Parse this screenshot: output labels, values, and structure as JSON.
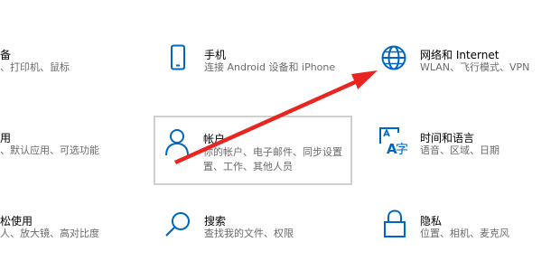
{
  "settings_tiles": [
    {
      "id": "devices",
      "title": "备",
      "desc": [
        "、打印机、鼠标"
      ]
    },
    {
      "id": "phone",
      "title": "手机",
      "desc": [
        "连接 Android 设备和 iPhone"
      ]
    },
    {
      "id": "network",
      "title": "网络和 Internet",
      "desc": [
        "WLAN、飞行模式、VPN"
      ]
    },
    {
      "id": "apps",
      "title": "用",
      "desc": [
        "、默认应用、可选功能"
      ]
    },
    {
      "id": "accounts",
      "title": "帐户",
      "desc": [
        "你的帐户、电子邮件、同步设置",
        "置、工作、其他人员"
      ]
    },
    {
      "id": "time-language",
      "title": "时间和语言",
      "desc": [
        "语音、区域、日期"
      ]
    },
    {
      "id": "ease-of-access",
      "title": "松使用",
      "desc": [
        "人、放大镜、高对比度"
      ]
    },
    {
      "id": "search",
      "title": "搜索",
      "desc": [
        "查找我的文件、权限"
      ]
    },
    {
      "id": "privacy",
      "title": "隐私",
      "desc": [
        "位置、相机、麦克风"
      ]
    }
  ],
  "colors": {
    "accent": "#0067c0",
    "arrow": "#e8251f",
    "hover_border": "#d0d0d0"
  },
  "icons": [
    "phone-icon",
    "globe-icon",
    "person-icon",
    "language-icon",
    "search-icon",
    "lock-icon",
    "arrow-annotation"
  ]
}
